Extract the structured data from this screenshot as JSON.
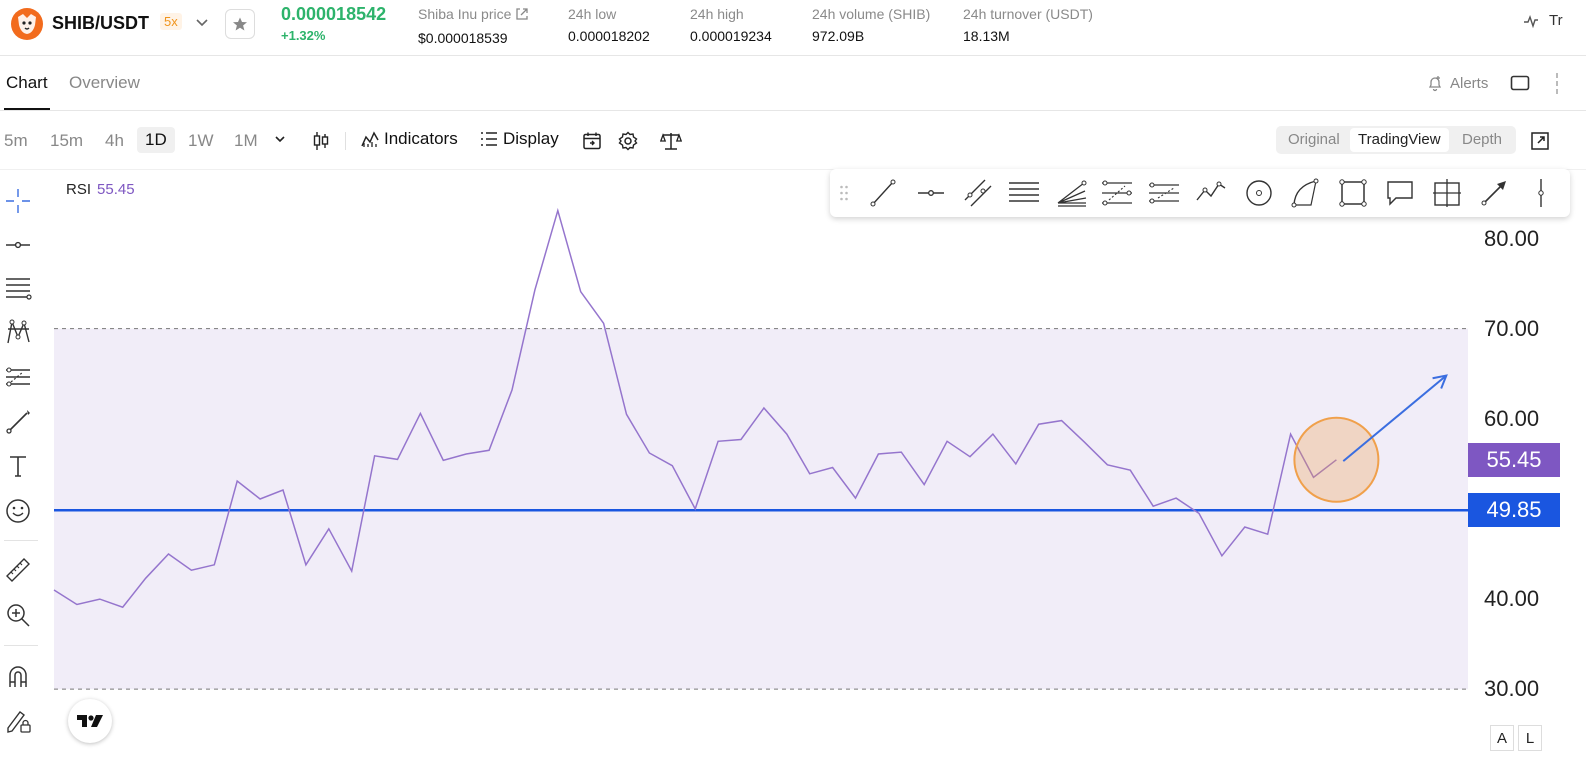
{
  "header": {
    "pair": "SHIB/USDT",
    "leverage": "5x",
    "last_price": "0.000018542",
    "change": "+1.32%",
    "stats": [
      {
        "label": "Shiba Inu price",
        "value": "$0.000018539",
        "has_link": true
      },
      {
        "label": "24h low",
        "value": "0.000018202"
      },
      {
        "label": "24h high",
        "value": "0.000019234"
      },
      {
        "label": "24h volume (SHIB)",
        "value": "972.09B"
      },
      {
        "label": "24h turnover (USDT)",
        "value": "18.13M"
      }
    ],
    "right_label": "Tr"
  },
  "tabs": {
    "items": [
      "Chart",
      "Overview"
    ],
    "active": "Chart",
    "alerts": "Alerts"
  },
  "toolbar": {
    "timeframes": [
      "5m",
      "15m",
      "4h",
      "1D",
      "1W",
      "1M"
    ],
    "active_timeframe": "1D",
    "indicators": "Indicators",
    "display": "Display",
    "views": [
      "Original",
      "TradingView",
      "Depth"
    ],
    "active_view": "TradingView"
  },
  "left_tools": [
    "crosshair-icon",
    "horizontal-line-icon",
    "fib-retracement-icon",
    "pattern-icon",
    "prediction-icon",
    "brush-icon",
    "text-icon",
    "emoji-icon",
    "ruler-icon",
    "zoom-in-icon",
    "magnet-icon",
    "lock-drawing-icon"
  ],
  "float_tools": [
    "drag-handle-icon",
    "trend-line-icon",
    "horizontal-ray-icon",
    "parallel-channel-icon",
    "horizontal-lines-icon",
    "fib-fan-icon",
    "fib-channel-icon",
    "fib-extension-icon",
    "zigzag-icon",
    "circle-icon",
    "arc-icon",
    "rectangle-icon",
    "callout-icon",
    "crosshair-box-icon",
    "arrow-icon",
    "vertical-line-icon"
  ],
  "indicator": {
    "name": "RSI",
    "value": "55.45"
  },
  "chart_data": {
    "type": "line",
    "title": "",
    "series": [
      {
        "values": [
          41,
          39.4,
          40,
          39.1,
          42.3,
          45,
          43.2,
          43.8,
          53.1,
          51.1,
          52.1,
          43.8,
          47.8,
          43.1,
          55.9,
          55.5,
          60.6,
          55.4,
          56.1,
          56.5,
          63.2,
          74.3,
          83.1,
          74.1,
          70.6,
          60.5,
          56.2,
          54.8,
          50,
          57.5,
          57.7,
          61.2,
          58.3,
          53.9,
          54.6,
          51.2,
          56.1,
          56.3,
          52.7,
          57.5,
          55.8,
          58.3,
          55,
          59.4,
          59.8,
          57.4,
          54.9,
          54.3,
          50.3,
          51.2,
          49.5,
          44.8,
          48,
          47.2,
          58.3,
          53.5,
          55.45
        ]
      }
    ],
    "ylim": [
      28.8,
      83.5
    ],
    "y_ticks": [
      "80.00",
      "70.00",
      "60.00",
      "40.00",
      "30.00"
    ],
    "band": {
      "upper": 70,
      "lower": 30
    },
    "horizontal_line": {
      "value": 49.85,
      "label": "49.85",
      "color": "#1a56e0"
    },
    "current_badge": {
      "value": 55.45,
      "label": "55.45",
      "color": "#7e57c2"
    },
    "line_color": "#9575cd",
    "band_color": "#f1edf8",
    "annotations": [
      {
        "kind": "circle",
        "x_index": 56,
        "y": 55.45,
        "color": "#f0a04b"
      },
      {
        "kind": "arrow",
        "from": [
          56.3,
          55.3
        ],
        "to": [
          60.8,
          64.8
        ],
        "color": "#3b6ee0"
      }
    ],
    "grid": false
  }
}
